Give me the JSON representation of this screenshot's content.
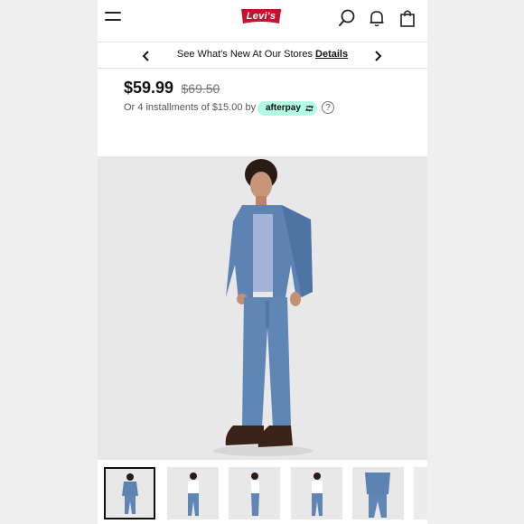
{
  "header": {
    "logo_text": "Levi's",
    "menu_icon": "hamburger-icon",
    "search_icon": "search-icon",
    "notifications_icon": "bell-icon",
    "bag_icon": "shopping-bag-icon",
    "brand_color": "#c41230"
  },
  "promo": {
    "text": "See What's New At Our Stores",
    "link": "Details",
    "prev_icon": "chevron-left-icon",
    "next_icon": "chevron-right-icon"
  },
  "price": {
    "current": "$59.99",
    "original": "$69.50",
    "installments_text": "Or 4 installments of $15.00 by",
    "afterpay_label": "afterpay",
    "afterpay_color": "#b2fce4",
    "help_symbol": "?"
  },
  "gallery": {
    "selected_index": 0,
    "thumbnail_count": 5
  }
}
